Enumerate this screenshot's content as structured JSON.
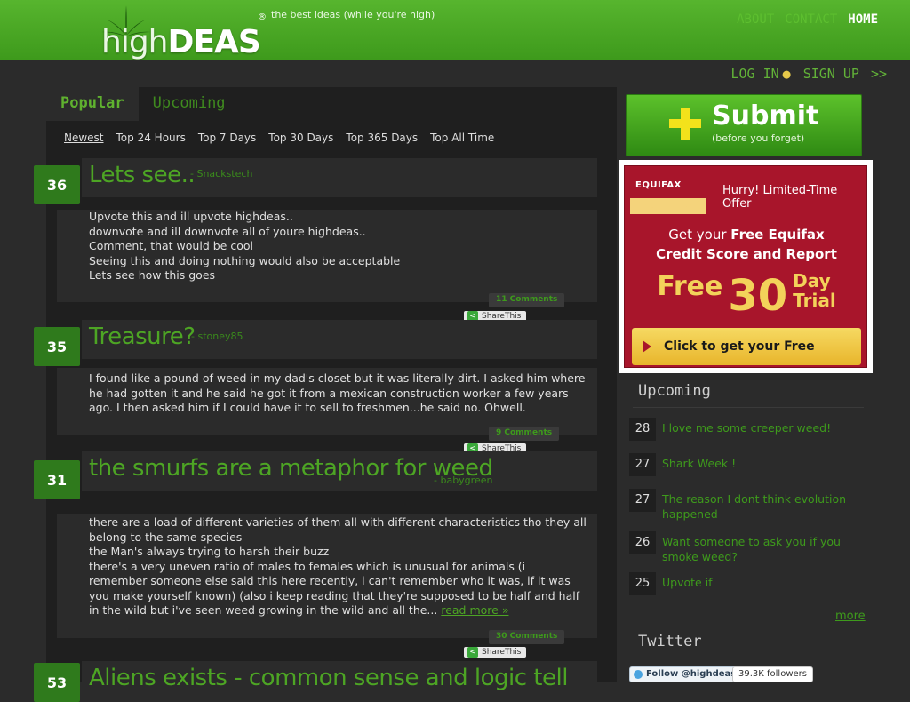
{
  "site": {
    "logo": {
      "thin": "high",
      "bold": "DEAS",
      "reg": "®"
    },
    "tagline": "the best ideas (while you're high)",
    "nav": [
      {
        "label": "ABOUT"
      },
      {
        "label": "CONTACT"
      },
      {
        "label": "HOME"
      }
    ]
  },
  "account": {
    "login": "LOG IN",
    "signup": "SIGN UP",
    "signup_arrows": ">>"
  },
  "main": {
    "tabs": [
      {
        "label": "Popular"
      },
      {
        "label": "Upcoming"
      }
    ],
    "filters": [
      "Newest",
      "Top 24 Hours",
      "Top 7 Days",
      "Top 30 Days",
      "Top 365 Days",
      "Top All Time"
    ],
    "posts": [
      {
        "votes": "36",
        "title": "Lets see..",
        "author": "- Snackstech",
        "body": [
          "Upvote this and ill upvote highdeas..",
          "downvote and ill downvote all of youre highdeas..",
          "Comment, that would be cool",
          "Seeing this and doing nothing would also be acceptable",
          "Lets see how this goes"
        ],
        "comments": "11 Comments",
        "share": "ShareThis"
      },
      {
        "votes": "35",
        "title": "Treasure?",
        "author": "- stoney85",
        "body": [
          "I found like a pound of weed in my dad's closet but it was literally dirt. I asked him where he had gotten it and he said he got it from a mexican construction worker a few years ago. I then asked him if I could have it to sell to freshmen...he said no. Ohwell."
        ],
        "comments": "9 Comments",
        "share": "ShareThis"
      },
      {
        "votes": "31",
        "title": "the smurfs are a metaphor for weed",
        "author": "- babygreen",
        "body": [
          "there are a load of different varieties of them all with different characteristics tho they all belong to the same species",
          "the Man's always trying to harsh their buzz",
          "there's a very uneven ratio of males to females which is unusual for animals (i remember someone else said this here recently, i can't remember who it was, if it was you make yourself known) (also i keep reading that they're supposed to be half and half in the wild but i've seen weed growing in the wild and all the..."
        ],
        "read_more": "read more »",
        "comments": "30 Comments",
        "share": "ShareThis"
      },
      {
        "votes": "53",
        "title": "Aliens exists - common sense and logic tell"
      }
    ]
  },
  "sidebar": {
    "submit": {
      "label": "Submit",
      "sub": "(before you forget)"
    },
    "ad": {
      "brand": "EQUIFAX",
      "hurry": "Hurry! Limited-Time Offer",
      "line1_pre": "Get your ",
      "line1_bold": "Free Equifax",
      "line2": "Credit Score and Report",
      "free": "Free",
      "number": "30",
      "day": "Day",
      "trial": "Trial",
      "cta": "Click to get your Free Score!"
    },
    "upcoming_heading": "Upcoming",
    "upcoming": [
      {
        "votes": "28",
        "title": "I love me some creeper weed!"
      },
      {
        "votes": "27",
        "title": "Shark Week !"
      },
      {
        "votes": "27",
        "title": "The reason I dont think evolution happened"
      },
      {
        "votes": "26",
        "title": "Want someone to ask you if you smoke weed?"
      },
      {
        "votes": "25",
        "title": "Upvote if"
      }
    ],
    "more": "more",
    "twitter_heading": "Twitter",
    "follow": "Follow @highdeas",
    "followers": "39.3K followers"
  },
  "colors": {
    "brand_green": "#4da524",
    "header_green": "#57b52e",
    "ad_red": "#a8152b",
    "ad_gold": "#f3d25a"
  }
}
